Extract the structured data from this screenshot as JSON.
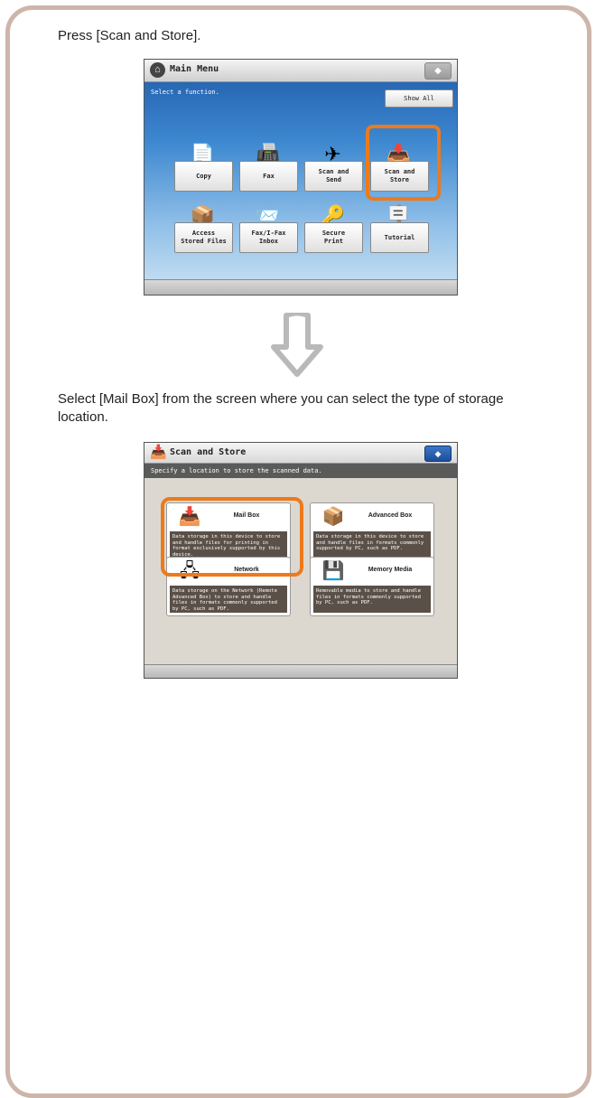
{
  "step1_text": "Press [Scan and Store].",
  "step2_text": "Select [Mail Box] from the screen where you can select the type of storage location.",
  "main_menu": {
    "title": "Main Menu",
    "subtitle": "Select a function.",
    "show_all": "Show All",
    "tiles": [
      {
        "label": "Copy",
        "icon": "copy-icon"
      },
      {
        "label": "Fax",
        "icon": "fax-icon"
      },
      {
        "label": "Scan and\nSend",
        "icon": "scan-send-icon"
      },
      {
        "label": "Scan and\nStore",
        "icon": "scan-store-icon"
      },
      {
        "label": "Access\nStored Files",
        "icon": "access-files-icon"
      },
      {
        "label": "Fax/I-Fax\nInbox",
        "icon": "fax-inbox-icon"
      },
      {
        "label": "Secure\nPrint",
        "icon": "secure-print-icon"
      },
      {
        "label": "Tutorial",
        "icon": "tutorial-icon"
      }
    ]
  },
  "scan_store": {
    "title": "Scan and Store",
    "subtitle": "Specify a location to store the scanned data.",
    "cards": [
      {
        "name": "Mail Box",
        "desc": "Data storage in this device to store and handle files for printing in format exclusively supported by this device.",
        "icon": "mail-box-icon"
      },
      {
        "name": "Advanced Box",
        "desc": "Data storage in this device to store and handle files in formats commonly supported by PC, such as PDF.",
        "icon": "advanced-box-icon"
      },
      {
        "name": "Network",
        "desc": "Data storage on the Network (Remote Advanced Box) to store and handle files in formats commonly supported by PC, such as PDF.",
        "icon": "network-icon"
      },
      {
        "name": "Memory Media",
        "desc": "Removable media to store and handle files in formats commonly supported by PC, such as PDF.",
        "icon": "memory-media-icon"
      }
    ]
  },
  "colors": {
    "frame": "#cdb5aa",
    "highlight": "#ec7a1c"
  }
}
